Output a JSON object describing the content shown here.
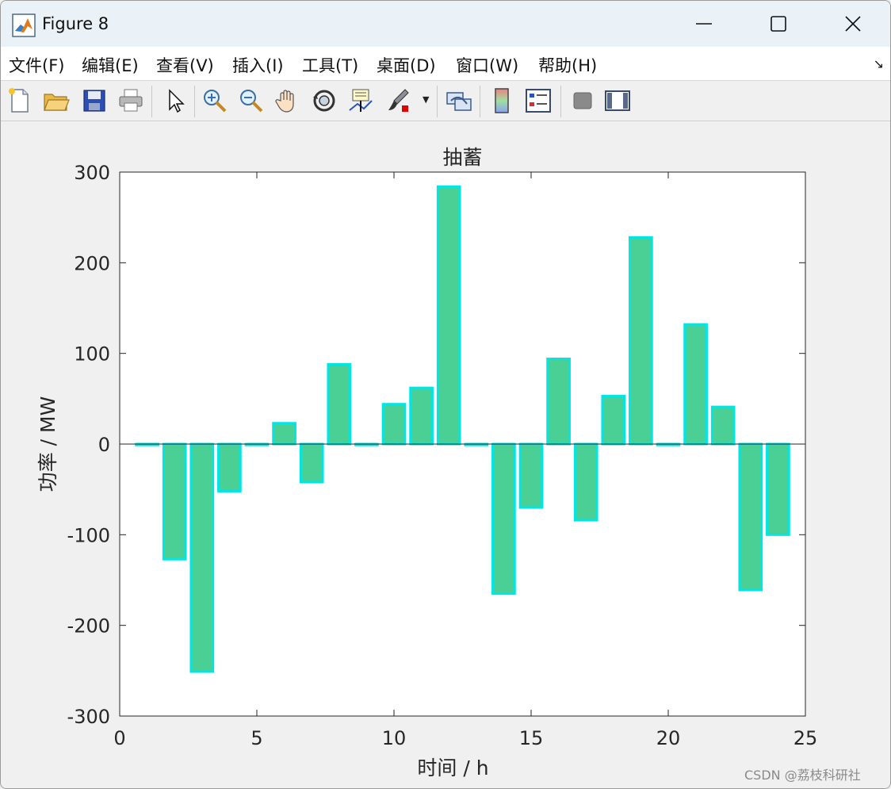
{
  "window": {
    "title": "Figure 8"
  },
  "menu": [
    {
      "label": "文件(F)"
    },
    {
      "label": "编辑(E)"
    },
    {
      "label": "查看(V)"
    },
    {
      "label": "插入(I)"
    },
    {
      "label": "工具(T)"
    },
    {
      "label": "桌面(D)"
    },
    {
      "label": "窗口(W)"
    },
    {
      "label": "帮助(H)"
    }
  ],
  "toolbar_icons": [
    "new-file-icon",
    "open-folder-icon",
    "save-icon",
    "print-icon",
    "pointer-icon",
    "zoom-in-icon",
    "zoom-out-icon",
    "pan-hand-icon",
    "rotate-3d-icon",
    "data-cursor-icon",
    "brush-icon",
    "link-plot-icon",
    "colorbar-icon",
    "legend-icon",
    "hide-plot-tools-icon",
    "show-plot-tools-icon"
  ],
  "watermark": "CSDN @荔枝科研社",
  "colors": {
    "bar_fill": "#4acf95",
    "bar_edge": "#00e5e5"
  },
  "chart_data": {
    "type": "bar",
    "title": "抽蓄",
    "xlabel": "时间 / h",
    "ylabel": "功率 / MW",
    "xlim": [
      0,
      25
    ],
    "ylim": [
      -300,
      300
    ],
    "xticks": [
      0,
      5,
      10,
      15,
      20,
      25
    ],
    "yticks": [
      -300,
      -200,
      -100,
      0,
      100,
      200,
      300
    ],
    "grid": false,
    "x": [
      1,
      2,
      3,
      4,
      5,
      6,
      7,
      8,
      9,
      10,
      11,
      12,
      13,
      14,
      15,
      16,
      17,
      18,
      19,
      20,
      21,
      22,
      23,
      24
    ],
    "values": [
      -1,
      -127,
      -251,
      -52,
      -1,
      23,
      -42,
      88,
      -1,
      44,
      62,
      284,
      -1,
      -165,
      -70,
      94,
      -84,
      53,
      228,
      -1,
      132,
      41,
      -161,
      -100
    ]
  }
}
